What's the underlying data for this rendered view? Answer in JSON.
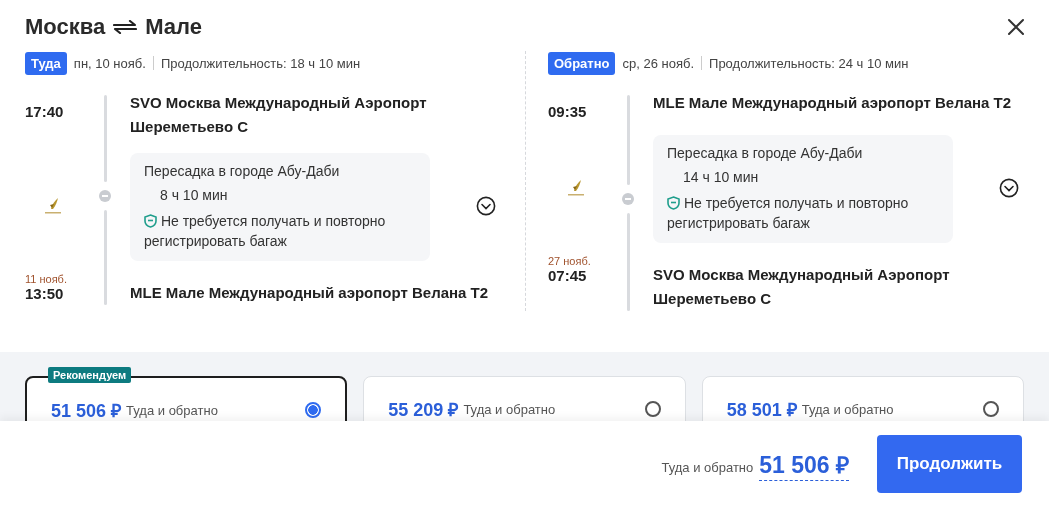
{
  "title": {
    "from": "Москва",
    "to": "Мале"
  },
  "legs": [
    {
      "tag": "Туда",
      "date": "пн, 10 нояб.",
      "duration": "Продолжительность: 18 ч 10 мин",
      "departure": {
        "time": "17:40",
        "airport": "SVO Москва Международный Аэропорт Шереметьево С"
      },
      "transfer": {
        "city": "Пересадка в городе Абу-Даби",
        "duration": "8 ч 10 мин",
        "note": "Не требуется получать и повторно регистрировать багаж"
      },
      "arrival": {
        "date": "11 нояб.",
        "time": "13:50",
        "airport": "MLE Мале Международный аэропорт Велана Т2"
      }
    },
    {
      "tag": "Обратно",
      "date": "ср, 26 нояб.",
      "duration": "Продолжительность: 24 ч 10 мин",
      "departure": {
        "time": "09:35",
        "airport": "MLE Мале Международный аэропорт Велана Т2"
      },
      "transfer": {
        "city": "Пересадка в городе Абу-Даби",
        "duration": "14 ч 10 мин",
        "note": "Не требуется получать и повторно регистрировать багаж"
      },
      "arrival": {
        "date": "27 нояб.",
        "time": "07:45",
        "airport": "SVO Москва Международный Аэропорт Шереметьево С"
      }
    }
  ],
  "fares": [
    {
      "price": "51 506 ₽",
      "label": "Туда и обратно",
      "selected": true,
      "badge": "Рекомендуем"
    },
    {
      "price": "55 209 ₽",
      "label": "Туда и обратно",
      "selected": false
    },
    {
      "price": "58 501 ₽",
      "label": "Туда и обратно",
      "selected": false
    }
  ],
  "footer": {
    "label": "Туда и обратно",
    "price": "51 506 ₽",
    "button": "Продолжить"
  }
}
